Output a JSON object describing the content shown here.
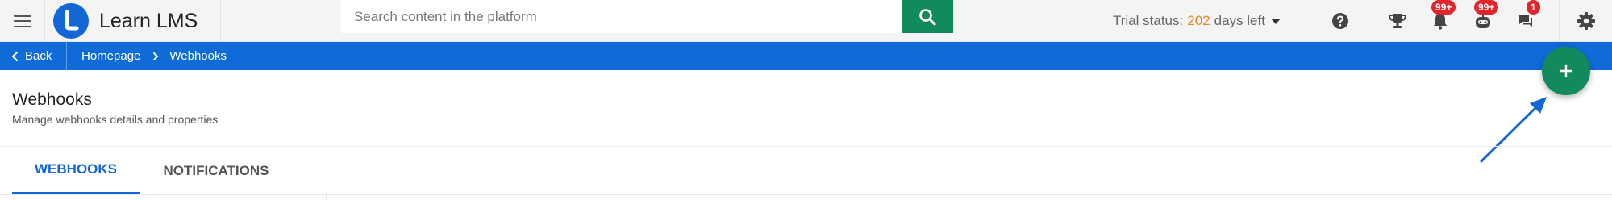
{
  "app": {
    "name": "Learn LMS",
    "logo_letter": "L"
  },
  "search": {
    "placeholder": "Search content in the platform",
    "value": ""
  },
  "trial": {
    "prefix": "Trial status:",
    "days": "202",
    "suffix": "days left"
  },
  "header_icons": [
    {
      "name": "help-icon"
    },
    {
      "name": "trophy-icon"
    },
    {
      "name": "notifications-bell-icon",
      "badge": "99+"
    },
    {
      "name": "robot-icon",
      "badge": "99+"
    },
    {
      "name": "messages-icon",
      "badge": "1"
    },
    {
      "name": "settings-gear-icon"
    }
  ],
  "nav": {
    "back_label": "Back",
    "breadcrumbs": [
      "Homepage",
      "Webhooks"
    ]
  },
  "page": {
    "title": "Webhooks",
    "subtitle": "Manage webhooks details and properties"
  },
  "tabs": [
    {
      "label": "WEBHOOKS",
      "active": true
    },
    {
      "label": "NOTIFICATIONS",
      "active": false
    }
  ],
  "fab": {
    "icon": "plus-icon"
  },
  "colors": {
    "primary_blue": "#0f6bd7",
    "accent_green": "#138a5e",
    "badge_red": "#e0252d",
    "trial_orange": "#e58a2c"
  }
}
